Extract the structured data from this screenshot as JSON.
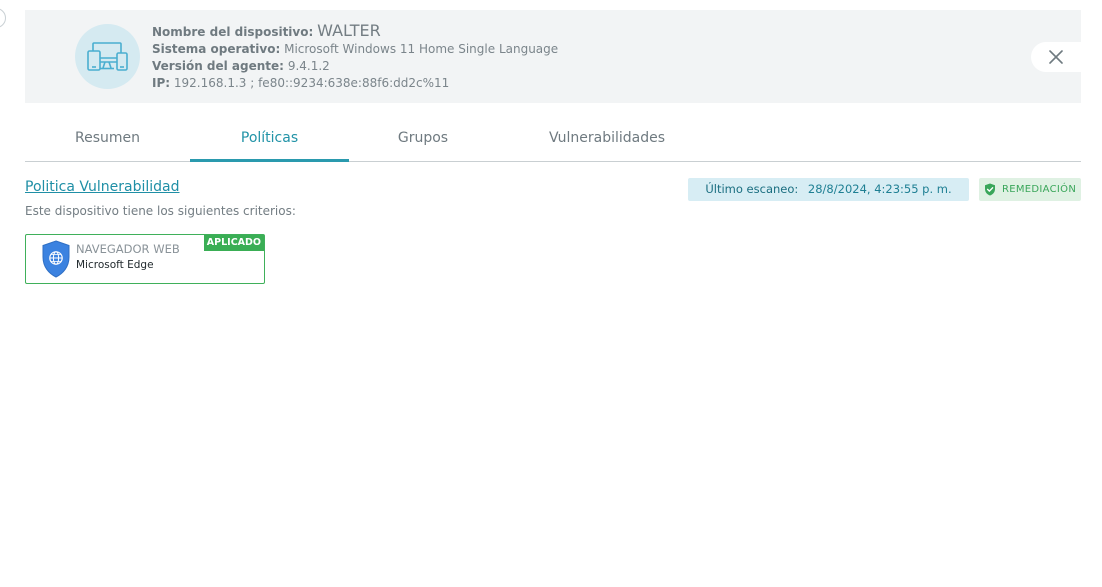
{
  "device": {
    "name_label": "Nombre del dispositivo:",
    "name_value": "WALTER",
    "os_label": "Sistema operativo:",
    "os_value": "Microsoft Windows 11 Home Single Language",
    "agent_label": "Versión del agente:",
    "agent_value": "9.4.1.2",
    "ip_label": "IP:",
    "ip_value": "192.168.1.3 ; fe80::9234:638e:88f6:dd2c%11",
    "avatar_icon": "devices-icon",
    "accent_color": "#d5eaf1"
  },
  "tabs": [
    {
      "label": "Resumen",
      "active": false
    },
    {
      "label": "Políticas",
      "active": true
    },
    {
      "label": "Grupos",
      "active": false
    },
    {
      "label": "Vulnerabilidades",
      "active": false
    }
  ],
  "policy": {
    "title": "Politica Vulnerabilidad",
    "description": "Este dispositivo tiene los siguientes criterios:",
    "last_scan_label": "Último escaneo:",
    "last_scan_value": "28/8/2024, 4:23:55 p. m.",
    "status_label": "REMEDIACIÓN",
    "status_color": "#3aa65a",
    "criteria": [
      {
        "category": "NAVEGADOR WEB",
        "value": "Microsoft Edge",
        "tag": "APLICADO",
        "icon": "globe-shield-icon",
        "border_color": "#3fb05a"
      }
    ]
  },
  "colors": {
    "primary": "#2193a7",
    "header_bg": "#f2f4f5",
    "success": "#3aae55"
  }
}
